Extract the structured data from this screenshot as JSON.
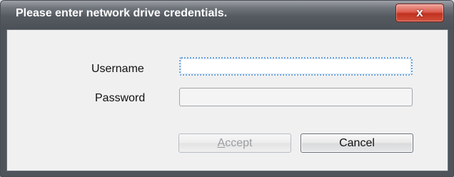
{
  "dialog": {
    "title": "Please enter network drive credentials.",
    "close_label": "x"
  },
  "form": {
    "username_label": "Username",
    "password_label": "Password",
    "username_value": "",
    "password_value": ""
  },
  "buttons": {
    "accept_mnemonic": "A",
    "accept_rest": "ccept",
    "cancel_label": "Cancel"
  }
}
